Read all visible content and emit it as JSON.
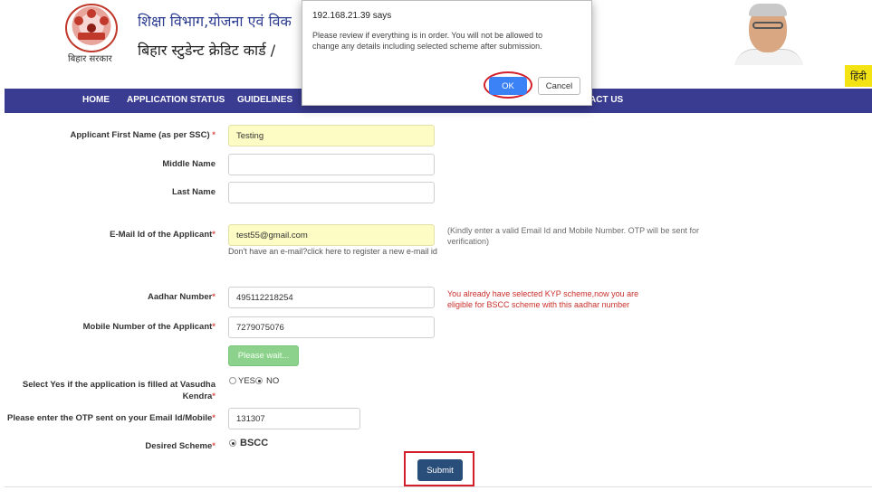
{
  "header": {
    "emblem_caption": "बिहार सरकार",
    "title": "शिक्षा विभाग,योजना एवं विक",
    "subtitle": "बिहार स्टुडेन्ट क्रेडिट कार्ड /",
    "lang_button": "हिंदी"
  },
  "nav": {
    "items": [
      "HOME",
      "APPLICATION STATUS",
      "GUIDELINES",
      "ACT US"
    ]
  },
  "dialog": {
    "origin": "192.168.21.39 says",
    "message": "Please review if everything is in order. You will not be allowed to change any details including selected scheme after submission.",
    "ok_label": "OK",
    "cancel_label": "Cancel"
  },
  "form": {
    "first_name_label": "Applicant First Name (as per SSC)",
    "first_name_value": "Testing",
    "middle_name_label": "Middle Name",
    "middle_name_value": "",
    "last_name_label": "Last Name",
    "last_name_value": "",
    "email_label": "E-Mail Id of the Applicant",
    "email_value": "test55@gmail.com",
    "email_register_hint": "Don't have an e-mail?click here to register a new e-mail id",
    "email_note": "(Kindly enter a valid Email Id and Mobile Number. OTP will be sent for verification)",
    "aadhar_label": "Aadhar Number",
    "aadhar_value": "495112218254",
    "aadhar_error": "You already have selected KYP scheme,now you are eligible for BSCC scheme with this aadhar number",
    "mobile_label": "Mobile Number of the Applicant",
    "mobile_value": "7279075076",
    "wait_button": "Please wait...",
    "vasudha_label_line1": "Select Yes if the application is filled at Vasudha",
    "vasudha_label_line2": "Kendra",
    "vasudha_yes": "YES",
    "vasudha_no": "NO",
    "vasudha_selected": "NO",
    "otp_label": "Please enter the OTP sent on your Email Id/Mobile",
    "otp_value": "131307",
    "scheme_label": "Desired Scheme",
    "scheme_value": "BSCC",
    "required_marker": "*",
    "submit_label": "Submit"
  },
  "colors": {
    "nav_bg": "#3a3c92",
    "highlight_input": "#fdfcc4",
    "submit_bg": "#2a4e7a",
    "error_text": "#c9302c",
    "annotation_red": "#d31f2a",
    "dialog_ok": "#3b82f6"
  }
}
